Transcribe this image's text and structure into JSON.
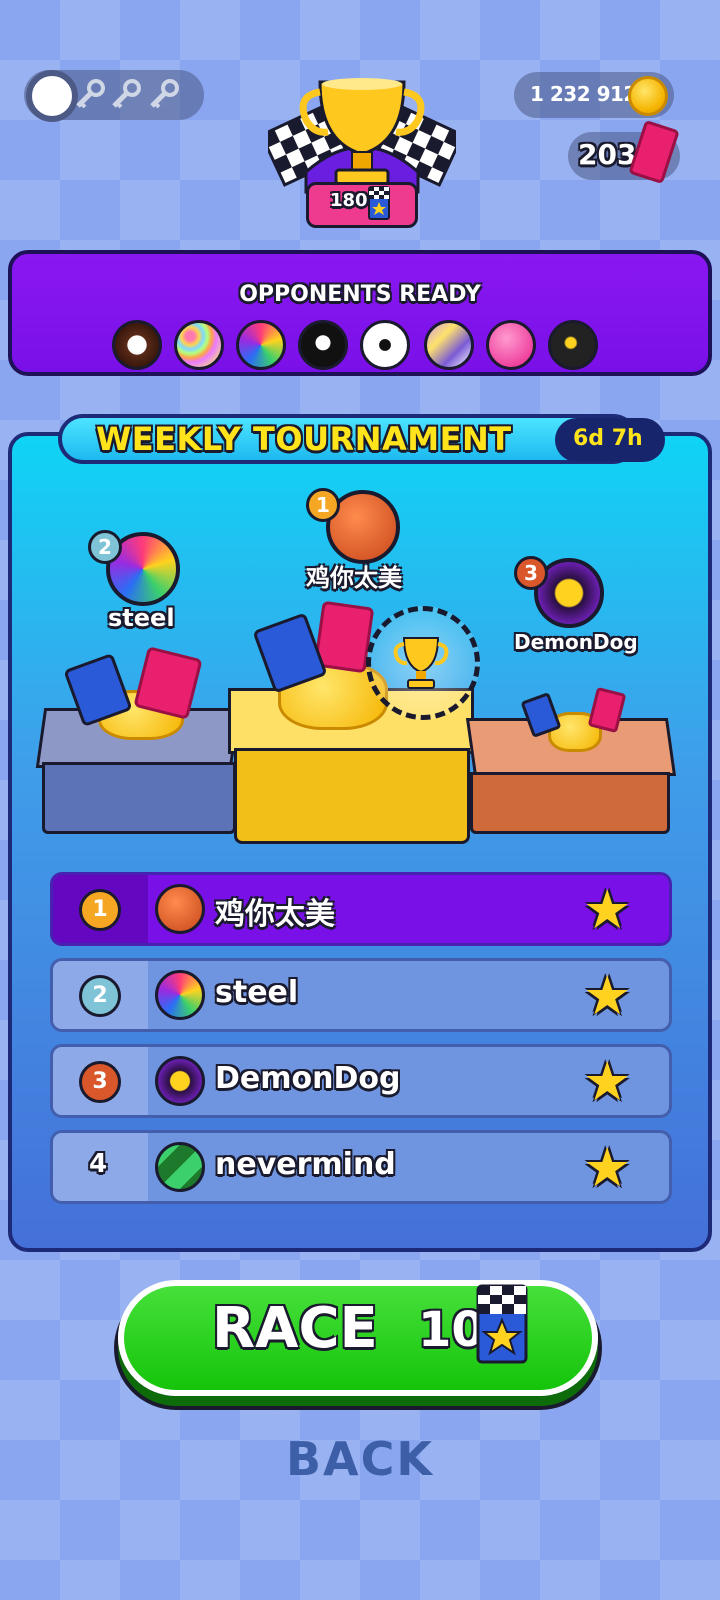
{
  "header": {
    "coins": "1 232 912",
    "tickets": "203",
    "trophy_badge": "180",
    "key_count_total": 3,
    "icons": [
      "key-icon",
      "coin-icon",
      "ticket-icon",
      "trophy-icon",
      "checkered-flag-icon"
    ]
  },
  "opponents": {
    "title": "OPPONENTS READY",
    "balls": [
      "cookie-ball",
      "sprinkles-ball",
      "rainbow-ball",
      "eight-ball",
      "soccer-ball",
      "marble-ball",
      "lollipop-ball",
      "bomb-ball"
    ]
  },
  "tournament": {
    "title": "WEEKLY TOURNAMENT",
    "timer": "6d 7h",
    "podium": [
      {
        "rank": "2",
        "name": "steel"
      },
      {
        "rank": "1",
        "name": "鸡你太美"
      },
      {
        "rank": "3",
        "name": "DemonDog"
      }
    ],
    "leaderboard": [
      {
        "rank": "1",
        "name": "鸡你太美",
        "avatar": "basketball-icon"
      },
      {
        "rank": "2",
        "name": "steel",
        "avatar": "rainbow-ball-icon"
      },
      {
        "rank": "3",
        "name": "DemonDog",
        "avatar": "tire-ball-icon"
      },
      {
        "rank": "4",
        "name": "nevermind",
        "avatar": "creeper-ball-icon"
      }
    ],
    "colors": {
      "first_row": "#7a10e8",
      "other_rows": "#6f95e0"
    }
  },
  "race": {
    "label": "RACE",
    "cost": "10"
  },
  "back": {
    "label": "BACK"
  }
}
